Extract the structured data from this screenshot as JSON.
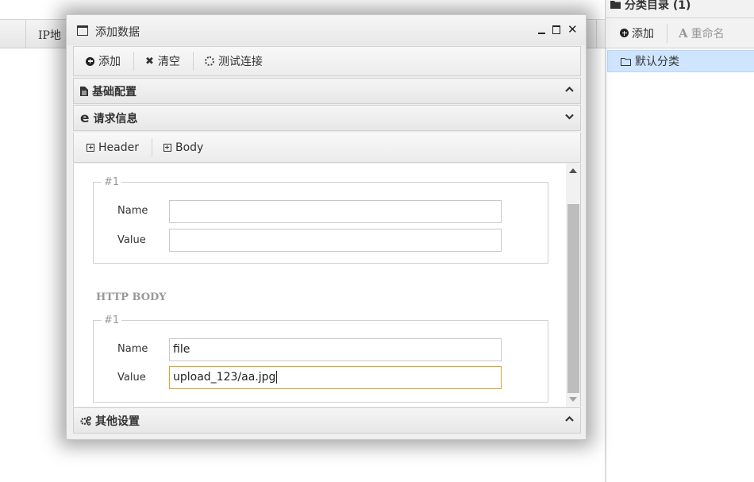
{
  "background": {
    "column_header": "IP地"
  },
  "right_panel": {
    "title": "分类目录 (1)",
    "add_label": "添加",
    "rename_label": "重命名",
    "tree_items": [
      {
        "label": "默认分类",
        "icon": "folder-outline-icon"
      }
    ]
  },
  "dialog": {
    "title": "添加数据",
    "toolbar": {
      "add_label": "添加",
      "clear_label": "清空",
      "test_label": "测试连接"
    },
    "sections": {
      "basic": {
        "label": "基础配置",
        "icon": "file-icon",
        "state": "collapsed"
      },
      "request": {
        "label": "请求信息",
        "icon": "ie-icon",
        "state": "expanded"
      },
      "other": {
        "label": "其他设置",
        "icon": "gears-icon",
        "state": "collapsed"
      }
    },
    "request_tabs": {
      "header_label": "Header",
      "body_label": "Body"
    },
    "header_params": [
      {
        "legend": "#1",
        "name_label": "Name",
        "name_value": "",
        "value_label": "Value",
        "value_value": ""
      }
    ],
    "body_section_title": "HTTP BODY",
    "body_params": [
      {
        "legend": "#1",
        "name_label": "Name",
        "name_value": "file",
        "value_label": "Value",
        "value_value": "upload_123/aa.jpg"
      }
    ]
  }
}
